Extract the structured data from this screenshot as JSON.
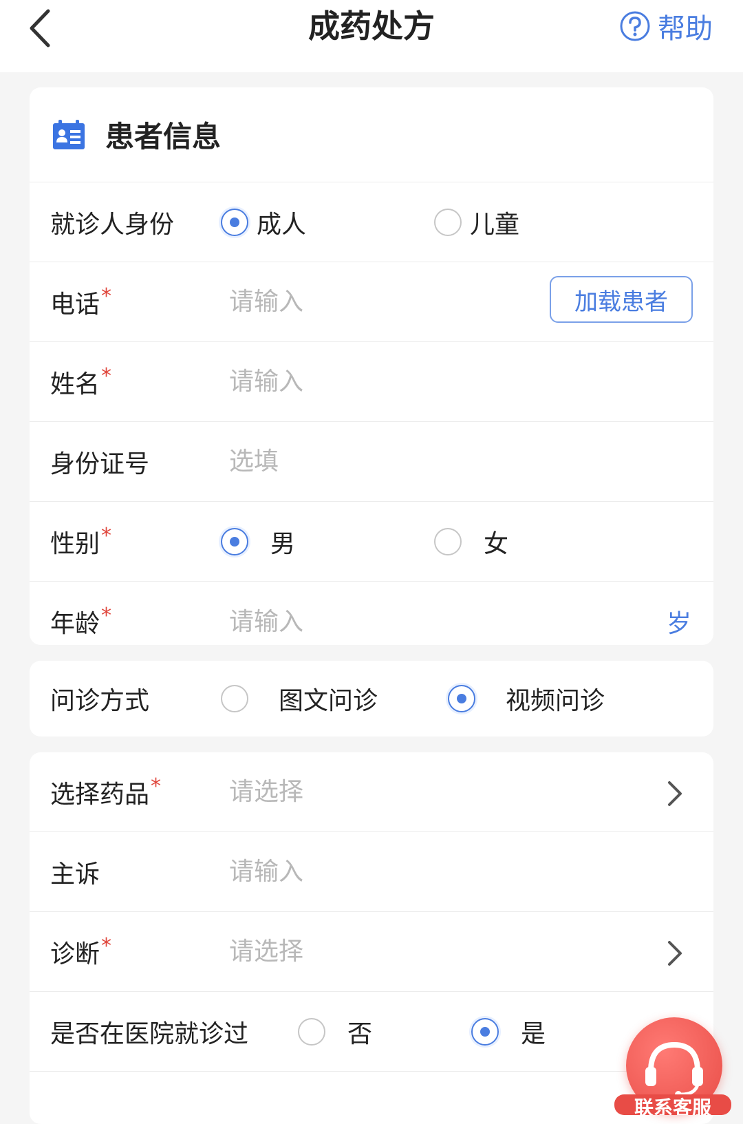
{
  "header": {
    "title": "成药处方",
    "help_label": "帮助"
  },
  "patient_card": {
    "title": "患者信息",
    "identity": {
      "label": "就诊人身份",
      "options": [
        "成人",
        "儿童"
      ],
      "selected": "成人"
    },
    "phone": {
      "label": "电话",
      "required": "*",
      "placeholder": "请输入",
      "load_button": "加载患者"
    },
    "name": {
      "label": "姓名",
      "required": "*",
      "placeholder": "请输入"
    },
    "id_number": {
      "label": "身份证号",
      "placeholder": "选填"
    },
    "gender": {
      "label": "性别",
      "required": "*",
      "options": [
        "男",
        "女"
      ],
      "selected": "男"
    },
    "age": {
      "label": "年龄",
      "required": "*",
      "placeholder": "请输入",
      "unit": "岁"
    }
  },
  "consult_card": {
    "method": {
      "label": "问诊方式",
      "options": [
        "图文问诊",
        "视频问诊"
      ],
      "selected": "视频问诊"
    }
  },
  "rx_card": {
    "drug": {
      "label": "选择药品",
      "required": "*",
      "placeholder": "请选择"
    },
    "complaint": {
      "label": "主诉",
      "placeholder": "请输入"
    },
    "diagnosis": {
      "label": "诊断",
      "required": "*",
      "placeholder": "请选择"
    },
    "visited": {
      "label": "是否在医院就诊过",
      "options": [
        "否",
        "是"
      ],
      "selected": "是"
    }
  },
  "customer_service": {
    "label": "联系客服"
  },
  "colors": {
    "accent": "#4a7de0",
    "required": "#e0463c",
    "placeholder": "#b8b8b8",
    "cs_red": "#e84c46"
  }
}
